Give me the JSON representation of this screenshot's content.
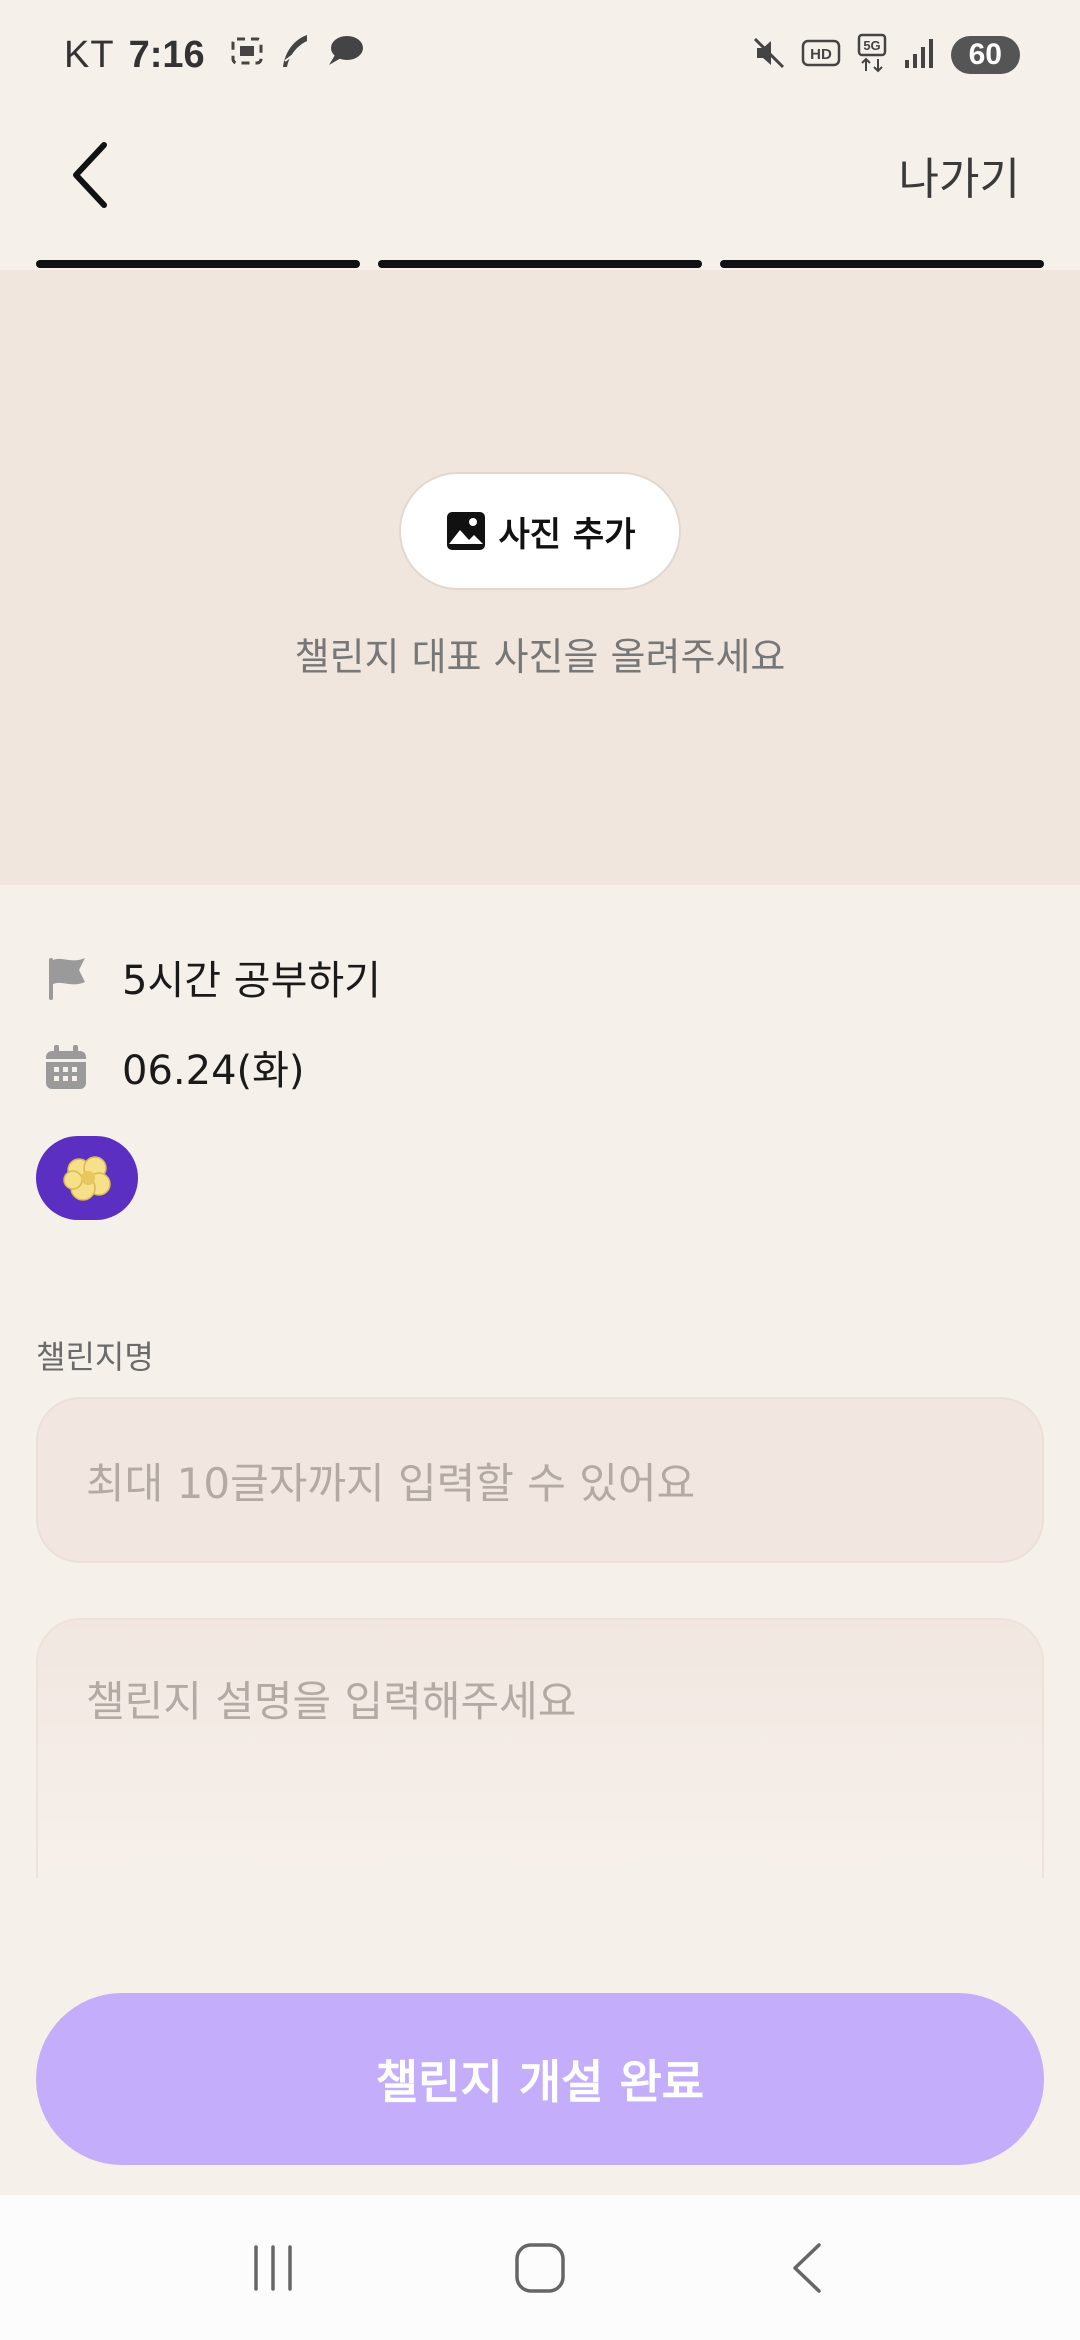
{
  "status_bar": {
    "carrier": "KT",
    "time": "7:16",
    "battery": "60",
    "icons_left": [
      "screenshot-icon",
      "feather-icon",
      "chat-bubble-icon"
    ],
    "icons_right": [
      "mute-icon",
      "hd-icon",
      "5g-icon",
      "signal-icon"
    ]
  },
  "header": {
    "exit_label": "나가기",
    "progress_steps": 3,
    "progress_completed": 3
  },
  "photo": {
    "add_label": "사진 추가",
    "hint": "챌린지 대표 사진을 올려주세요"
  },
  "info": {
    "goal": "5시간 공부하기",
    "date": "06.24(화)"
  },
  "form": {
    "name_label": "챌린지명",
    "name_placeholder": "최대 10글자까지 입력할 수 있어요",
    "description_placeholder": "챌린지 설명을 입력해주세요"
  },
  "submit_label": "챌린지 개설 완료",
  "colors": {
    "background": "#f6f0eb",
    "photo_area": "#f0e6de",
    "accent_purple": "#5a2fc2",
    "submit_disabled": "#c4adfb"
  }
}
